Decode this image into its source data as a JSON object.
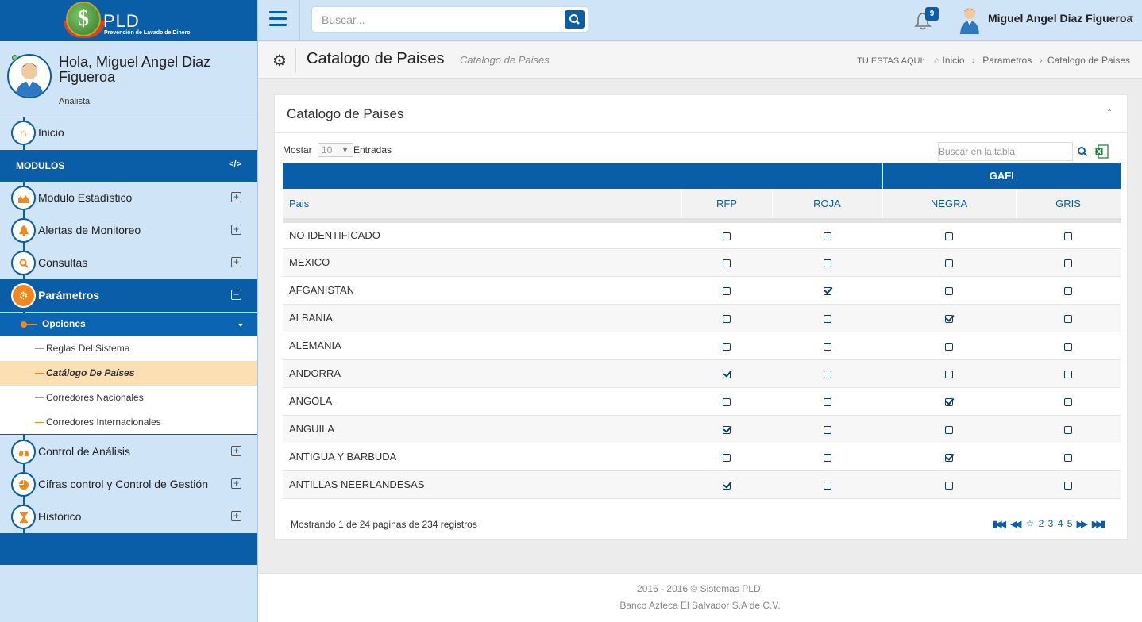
{
  "app": {
    "logo_text": "PLD",
    "logo_subtitle": "Prevención de Lavado de Dinero"
  },
  "profile": {
    "greeting": "Hola, Miguel Angel Diaz Figueroa",
    "role": "Analista"
  },
  "sidebar": {
    "inicio_label": "Inicio",
    "modulos_label": "MODULOS",
    "items": [
      {
        "label": "Modulo Estadístico",
        "icon": "chart-icon"
      },
      {
        "label": "Alertas de Monitoreo",
        "icon": "bell-icon"
      },
      {
        "label": "Consultas",
        "icon": "search-icon"
      },
      {
        "label": "Parámetros",
        "icon": "settings-icon"
      },
      {
        "label": "Control de Análisis",
        "icon": "lungs-icon"
      },
      {
        "label": "Cifras control y Control de Gestión",
        "icon": "pie-icon"
      },
      {
        "label": "Histórico",
        "icon": "hourglass-icon"
      }
    ],
    "opciones_label": "Opciones",
    "submenu": [
      {
        "label": "Reglas Del Sistema",
        "active": false
      },
      {
        "label": "Catálogo De Países",
        "active": true
      },
      {
        "label": "Corredores Nacionales",
        "active": false
      },
      {
        "label": "Corredores Internacionales",
        "active": false
      }
    ]
  },
  "topbar": {
    "search_placeholder": "Buscar...",
    "notifications_count": "9",
    "username": "Miguel Angel Diaz Figueroa"
  },
  "header": {
    "title": "Catalogo de Paises",
    "subtitle": "Catalogo de Paises",
    "breadcrumb_lead": "TU ESTAS AQUI:",
    "breadcrumb": [
      "Inicio",
      "Parametros",
      "Catalogo de Paises"
    ]
  },
  "panel": {
    "title": "Catalogo de Paises",
    "length_label_pre": "Mostar",
    "length_value": "10",
    "length_label_post": "Entradas",
    "table_search_placeholder": "Buscar en la tabla",
    "group_header": "GAFI",
    "columns": [
      "Pais",
      "RFP",
      "ROJA",
      "NEGRA",
      "GRIS"
    ],
    "rows": [
      {
        "pais": "NO IDENTIFICADO",
        "rfp": false,
        "roja": false,
        "negra": false,
        "gris": false
      },
      {
        "pais": "MEXICO",
        "rfp": false,
        "roja": false,
        "negra": false,
        "gris": false
      },
      {
        "pais": "AFGANISTAN",
        "rfp": false,
        "roja": true,
        "negra": false,
        "gris": false
      },
      {
        "pais": "ALBANIA",
        "rfp": false,
        "roja": false,
        "negra": true,
        "gris": false
      },
      {
        "pais": "ALEMANIA",
        "rfp": false,
        "roja": false,
        "negra": false,
        "gris": false
      },
      {
        "pais": "ANDORRA",
        "rfp": true,
        "roja": false,
        "negra": false,
        "gris": false
      },
      {
        "pais": "ANGOLA",
        "rfp": false,
        "roja": false,
        "negra": true,
        "gris": false
      },
      {
        "pais": "ANGUILA",
        "rfp": true,
        "roja": false,
        "negra": false,
        "gris": false
      },
      {
        "pais": "ANTIGUA Y BARBUDA",
        "rfp": false,
        "roja": false,
        "negra": true,
        "gris": false
      },
      {
        "pais": "ANTILLAS NEERLANDESAS",
        "rfp": true,
        "roja": false,
        "negra": false,
        "gris": false
      }
    ],
    "info": "Mostrando 1 de 24 paginas de 234 registros",
    "pages": [
      "2",
      "3",
      "4",
      "5"
    ]
  },
  "footer": {
    "line1": "2016 - 2016 © Sistemas PLD.",
    "line2": "Banco Azteca El Salvador S.A de C.V."
  },
  "colors": {
    "primary": "#0a5ea8",
    "sidebar_bg": "#cfe4f7",
    "accent": "#f0871f",
    "active_row": "#fce0b4"
  }
}
